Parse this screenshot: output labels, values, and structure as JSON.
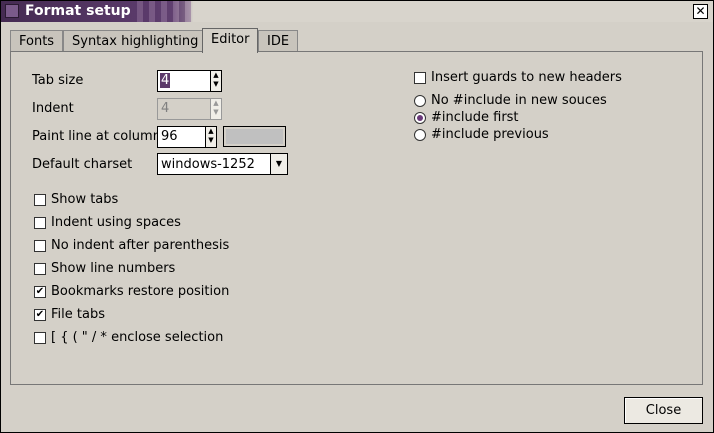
{
  "window": {
    "title": "Format setup"
  },
  "tabs": [
    {
      "label": "Fonts"
    },
    {
      "label": "Syntax highlighting"
    },
    {
      "label": "Editor",
      "active": true
    },
    {
      "label": "IDE"
    }
  ],
  "editor": {
    "tab_size": {
      "label": "Tab size",
      "value": "4"
    },
    "indent": {
      "label": "Indent",
      "value": "4"
    },
    "paint_line": {
      "label": "Paint line at column",
      "value": "96",
      "color": "#c0c0c0"
    },
    "charset": {
      "label": "Default charset",
      "value": "windows-1252"
    },
    "checkboxes": [
      {
        "label": "Show tabs",
        "checked": false
      },
      {
        "label": "Indent using spaces",
        "checked": false
      },
      {
        "label": "No indent after parenthesis",
        "checked": false
      },
      {
        "label": "Show line numbers",
        "checked": false
      },
      {
        "label": "Bookmarks restore position",
        "checked": true
      },
      {
        "label": "File tabs",
        "checked": true
      },
      {
        "label": "[ { ( \" / * enclose selection",
        "checked": false
      }
    ],
    "guards": {
      "label": "Insert guards to new headers",
      "checked": false
    },
    "include_options": [
      {
        "label": "No #include in new souces",
        "selected": false
      },
      {
        "label": "#include first",
        "selected": true
      },
      {
        "label": "#include previous",
        "selected": false
      }
    ]
  },
  "footer": {
    "close_label": "Close"
  },
  "colors": {
    "accent": "#5c3a6a",
    "background": "#d4d0c8"
  }
}
